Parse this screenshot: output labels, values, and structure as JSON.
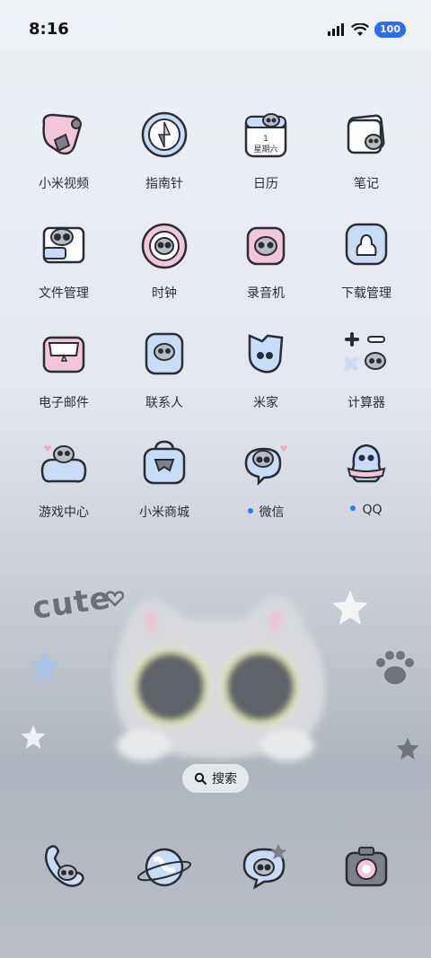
{
  "status_bar": {
    "time": "8:16",
    "battery": "100"
  },
  "apps": [
    {
      "label": "小米视频",
      "icon": "video-icon"
    },
    {
      "label": "指南针",
      "icon": "compass-icon"
    },
    {
      "label": "日历",
      "icon": "calendar-icon",
      "cal_day": "1",
      "cal_week": "星期六"
    },
    {
      "label": "笔记",
      "icon": "notes-icon"
    },
    {
      "label": "文件管理",
      "icon": "files-icon"
    },
    {
      "label": "时钟",
      "icon": "clock-icon"
    },
    {
      "label": "录音机",
      "icon": "recorder-icon"
    },
    {
      "label": "下载管理",
      "icon": "download-icon"
    },
    {
      "label": "电子邮件",
      "icon": "email-icon"
    },
    {
      "label": "联系人",
      "icon": "contacts-icon"
    },
    {
      "label": "米家",
      "icon": "mijia-icon"
    },
    {
      "label": "计算器",
      "icon": "calculator-icon"
    },
    {
      "label": "游戏中心",
      "icon": "game-center-icon"
    },
    {
      "label": "小米商城",
      "icon": "mi-store-icon"
    },
    {
      "label": "微信",
      "icon": "wechat-icon",
      "new_dot": true
    },
    {
      "label": "QQ",
      "icon": "qq-icon",
      "new_dot": true
    }
  ],
  "wallpaper": {
    "text": "cute"
  },
  "search": {
    "label": "搜索"
  },
  "dock": [
    {
      "icon": "phone-icon"
    },
    {
      "icon": "browser-icon"
    },
    {
      "icon": "messages-icon"
    },
    {
      "icon": "camera-icon"
    }
  ],
  "colors": {
    "pink": "#f3c6d8",
    "blue": "#c9dcf5",
    "outline": "#2a2d33",
    "accent_dot": "#2f7df6"
  }
}
